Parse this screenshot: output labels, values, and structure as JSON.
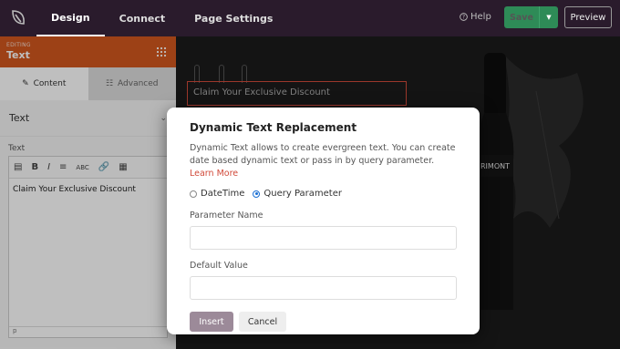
{
  "topbar": {
    "tabs": [
      "Design",
      "Connect",
      "Page Settings"
    ],
    "help_label": "Help",
    "save_label": "Save",
    "preview_label": "Preview"
  },
  "panel": {
    "editing_small": "EDITING",
    "editing_title": "Text",
    "tab_content": "Content",
    "tab_advanced": "Advanced",
    "section_title": "Text",
    "field_label": "Text",
    "editor_content": "Claim Your Exclusive Discount",
    "editor_footer": "p"
  },
  "canvas": {
    "headline": "Claim Your Exclusive Discount",
    "bottle_label": "RIMONT"
  },
  "modal": {
    "title": "Dynamic Text Replacement",
    "description": "Dynamic Text allows to create evergreen text. You can create date based dynamic text or pass in by query parameter.",
    "learn_more": "Learn More",
    "radio_datetime": "DateTime",
    "radio_query": "Query Parameter",
    "param_label": "Parameter Name",
    "default_label": "Default Value",
    "insert_label": "Insert",
    "cancel_label": "Cancel"
  },
  "colors": {
    "topbar_bg": "#2a1b2c",
    "accent_orange": "#d2571e",
    "save_green": "#2e8b57",
    "insert_mauve": "#9c8a99",
    "link_red": "#d14a3a"
  }
}
